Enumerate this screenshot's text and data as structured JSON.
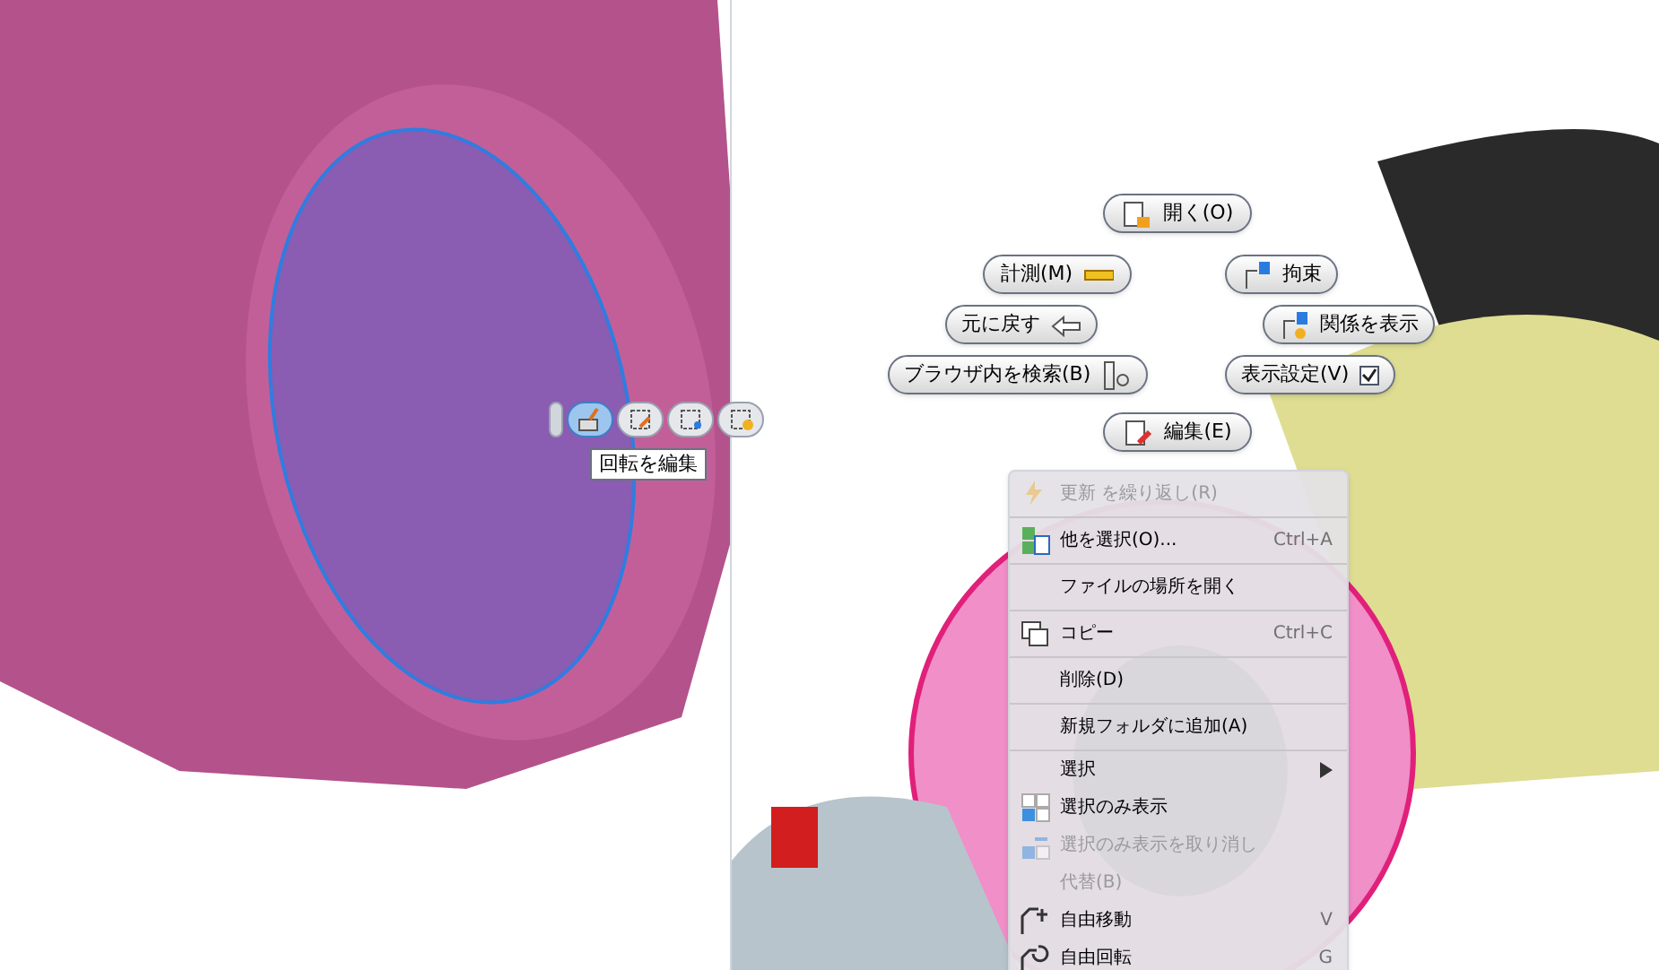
{
  "part_toolbar": {
    "buttons": [
      {
        "selected": true
      },
      {
        "selected": false
      },
      {
        "selected": false
      },
      {
        "selected": false
      }
    ],
    "tooltip": "回転を編集"
  },
  "marking_menu": [
    {
      "label": "開く(O)"
    },
    {
      "label": "計測(M)"
    },
    {
      "label": "拘束"
    },
    {
      "label": "元に戻す"
    },
    {
      "label": "関係を表示"
    },
    {
      "label": "ブラウザ内を検索(B)"
    },
    {
      "label": "表示設定(V)",
      "checked": true
    },
    {
      "label": "編集(E)"
    }
  ],
  "context_menu": [
    {
      "label": "更新 を繰り返し(R)",
      "disabled": true,
      "separator_after": true
    },
    {
      "label": "他を選択(O)...",
      "shortcut": "Ctrl+A",
      "disabled": false,
      "separator_after": true
    },
    {
      "label": "ファイルの場所を開く",
      "disabled": false,
      "separator_after": true
    },
    {
      "label": "コピー",
      "shortcut": "Ctrl+C",
      "disabled": false,
      "separator_after": true
    },
    {
      "label": "削除(D)",
      "disabled": false,
      "separator_after": true
    },
    {
      "label": "新規フォルダに追加(A)",
      "disabled": false,
      "separator_after": true
    },
    {
      "label": "選択",
      "submenu": true,
      "disabled": false,
      "separator_after": false
    },
    {
      "label": "選択のみ表示",
      "disabled": false,
      "separator_after": false
    },
    {
      "label": "選択のみ表示を取り消し",
      "disabled": true,
      "separator_after": false
    },
    {
      "label": "代替(B)",
      "disabled": true,
      "separator_after": false
    },
    {
      "label": "自由移動",
      "shortcut": "V",
      "disabled": false,
      "separator_after": false
    },
    {
      "label": "自由回転",
      "shortcut": "G",
      "disabled": false
    }
  ]
}
